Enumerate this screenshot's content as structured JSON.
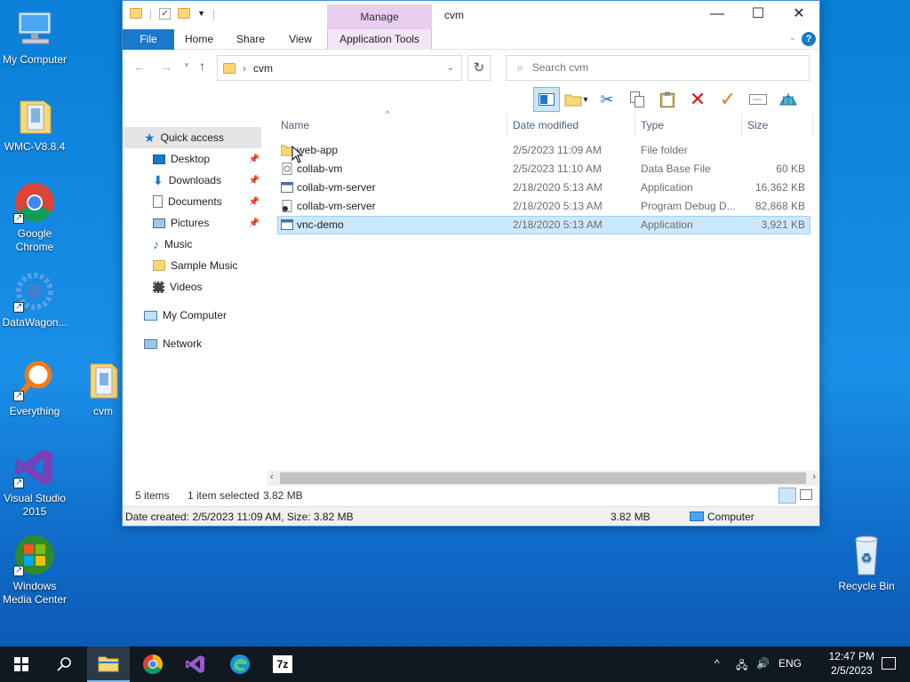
{
  "desktop": {
    "icons": [
      {
        "label": "My Computer"
      },
      {
        "label": "WMC-V8.8.4"
      },
      {
        "label": "Google Chrome"
      },
      {
        "label": "DataWagon..."
      },
      {
        "label": "Everything"
      },
      {
        "label": "cvm"
      },
      {
        "label": "Visual Studio 2015"
      },
      {
        "label": "Windows Media Center"
      },
      {
        "label": "Recycle Bin"
      }
    ]
  },
  "window": {
    "title": "cvm",
    "manage_label": "Manage",
    "tabs": {
      "file": "File",
      "home": "Home",
      "share": "Share",
      "view": "View",
      "app_tools": "Application Tools"
    },
    "help": "?",
    "address": {
      "path": "cvm",
      "separator": "›"
    },
    "search": {
      "placeholder": "Search cvm"
    },
    "nav": {
      "quick_access": "Quick access",
      "desktop": "Desktop",
      "downloads": "Downloads",
      "documents": "Documents",
      "pictures": "Pictures",
      "music": "Music",
      "sample_music": "Sample Music",
      "videos": "Videos",
      "my_computer": "My Computer",
      "network": "Network"
    },
    "columns": {
      "name": "Name",
      "date": "Date modified",
      "type": "Type",
      "size": "Size"
    },
    "files": [
      {
        "name": "web-app",
        "date": "2/5/2023 11:09 AM",
        "type": "File folder",
        "size": "",
        "icon": "folder-icon"
      },
      {
        "name": "collab-vm",
        "date": "2/5/2023 11:10 AM",
        "type": "Data Base File",
        "size": "60 KB",
        "icon": "database-file-icon"
      },
      {
        "name": "collab-vm-server",
        "date": "2/18/2020 5:13 AM",
        "type": "Application",
        "size": "16,362 KB",
        "icon": "application-icon"
      },
      {
        "name": "collab-vm-server",
        "date": "2/18/2020 5:13 AM",
        "type": "Program Debug D...",
        "size": "82,868 KB",
        "icon": "debug-file-icon"
      },
      {
        "name": "vnc-demo",
        "date": "2/18/2020 5:13 AM",
        "type": "Application",
        "size": "3,921 KB",
        "icon": "application-icon"
      }
    ],
    "status": {
      "items": "5 items",
      "selected": "1 item selected",
      "selected_size": "3.82 MB"
    },
    "details": {
      "info": "Date created: 2/5/2023 11:09 AM, Size: 3.82 MB",
      "size": "3.82 MB",
      "location": "Computer"
    }
  },
  "taskbar": {
    "lang": "ENG",
    "time": "12:47 PM",
    "date": "2/5/2023"
  },
  "colors": {
    "accent": "#1979ca",
    "selection": "#cce8ff",
    "manage": "#e8cdef",
    "folder": "#f8d775"
  }
}
